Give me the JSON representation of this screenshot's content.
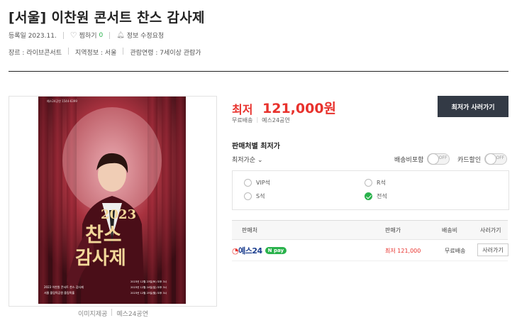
{
  "title": "[서울] 이찬원 콘서트 찬스 감사제",
  "meta": {
    "registered": "등록일 2023.11.",
    "wish": "찜하기",
    "wish_count": "0",
    "report": "정보 수정요청"
  },
  "info": {
    "genre": "장르 : 라이브콘서트",
    "region": "지역정보 : 서울",
    "age": "관람연령 : 7세이상 관람가"
  },
  "poster": {
    "brand": "예스24공연 1544-6399",
    "year": "2023",
    "title1": "찬스",
    "title2": "감사제",
    "line1": "2023 이찬원 콘서트 찬스 감사제",
    "line2": "서울 올림픽공원 올림픽홀",
    "date1": "2023년 12월 23일(토) 오후 3시",
    "date2": "2023년 12월 24일(일) 오후 3시",
    "date3": "2023년 12월 25일(월) 오후 3시"
  },
  "image_caption": {
    "label": "이미지제공",
    "source": "예스24공연"
  },
  "price": {
    "label": "최저",
    "value": "121,000원",
    "shipping": "무료배송",
    "seller": "예스24공연",
    "button": "최저가 사러가기"
  },
  "section_title": "판매처별 최저가",
  "sort_label": "최저가순",
  "toggles": [
    {
      "label": "배송비포함",
      "state": "OFF"
    },
    {
      "label": "카드할인",
      "state": "OFF"
    }
  ],
  "seats": [
    {
      "label": "VIP석",
      "checked": false
    },
    {
      "label": "R석",
      "checked": false
    },
    {
      "label": "S석",
      "checked": false
    },
    {
      "label": "전석",
      "checked": true
    }
  ],
  "table": {
    "headers": [
      "판매처",
      "판매가",
      "배송비",
      "사러가기"
    ],
    "rows": [
      {
        "seller": "예스24",
        "pay": "N pay",
        "price": "최저 121,000",
        "shipping": "무료배송",
        "action": "사러가기"
      }
    ]
  },
  "colors": {
    "accent": "#e8322d",
    "button": "#333a45",
    "green": "#2ab24c"
  }
}
